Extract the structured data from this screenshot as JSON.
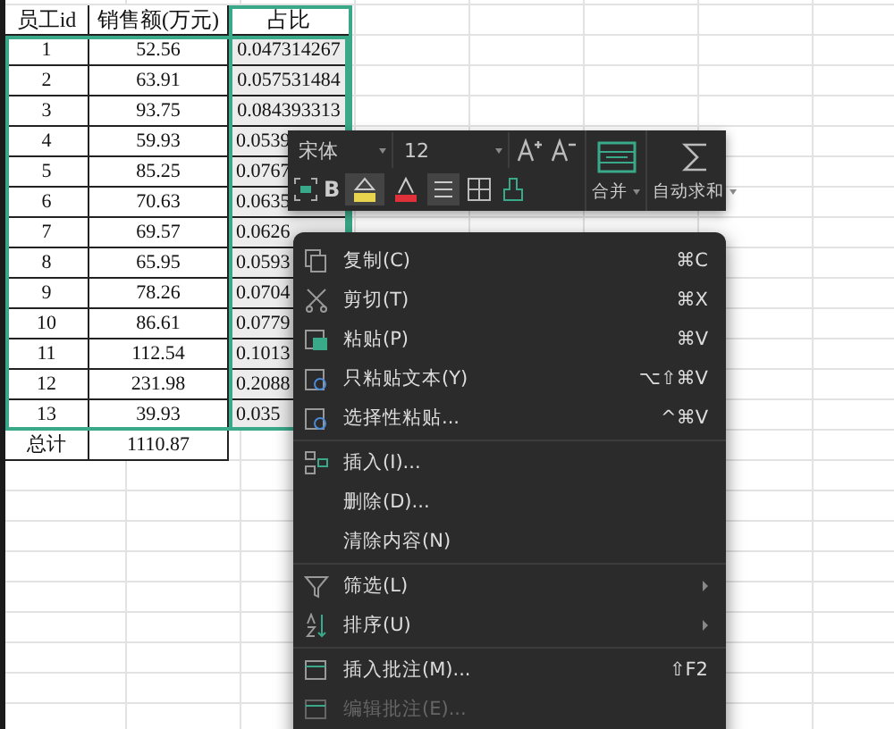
{
  "table": {
    "columns": [
      "员工id",
      "销售额(万元)",
      "占比"
    ],
    "rows": [
      [
        "1",
        "52.56",
        "0.047314267"
      ],
      [
        "2",
        "63.91",
        "0.057531484"
      ],
      [
        "3",
        "93.75",
        "0.084393313"
      ],
      [
        "4",
        "59.93",
        "0.0539"
      ],
      [
        "5",
        "85.25",
        "0.0767"
      ],
      [
        "6",
        "70.63",
        "0.0635"
      ],
      [
        "7",
        "69.57",
        "0.0626"
      ],
      [
        "8",
        "65.95",
        "0.0593"
      ],
      [
        "9",
        "78.26",
        "0.0704"
      ],
      [
        "10",
        "86.61",
        "0.0779"
      ],
      [
        "11",
        "112.54",
        "0.1013"
      ],
      [
        "12",
        "231.98",
        "0.2088"
      ],
      [
        "13",
        "39.93",
        "0.035"
      ],
      [
        "总计",
        "1110.87"
      ]
    ]
  },
  "toolbar": {
    "font": "宋体",
    "size": "12",
    "bold_label": "B",
    "merge_label": "合并",
    "autosum_label": "自动求和"
  },
  "context_menu": {
    "groups": [
      [
        {
          "label": "复制(C)",
          "shortcut": "⌘C",
          "disabled": false,
          "submenu": false
        },
        {
          "label": "剪切(T)",
          "shortcut": "⌘X",
          "disabled": false,
          "submenu": false
        },
        {
          "label": "粘贴(P)",
          "shortcut": "⌘V",
          "disabled": false,
          "submenu": false
        },
        {
          "label": "只粘贴文本(Y)",
          "shortcut": "⌥⇧⌘V",
          "disabled": false,
          "submenu": false
        },
        {
          "label": "选择性粘贴...",
          "shortcut": "^⌘V",
          "disabled": false,
          "submenu": false
        }
      ],
      [
        {
          "label": "插入(I)...",
          "disabled": false,
          "submenu": false
        },
        {
          "label": "删除(D)...",
          "disabled": false,
          "submenu": false
        },
        {
          "label": "清除内容(N)",
          "disabled": false,
          "submenu": false
        }
      ],
      [
        {
          "label": "筛选(L)",
          "disabled": false,
          "submenu": true
        },
        {
          "label": "排序(U)",
          "disabled": false,
          "submenu": true
        }
      ],
      [
        {
          "label": "插入批注(M)...",
          "shortcut": "⇧F2",
          "disabled": false,
          "submenu": false
        },
        {
          "label": "编辑批注(E)...",
          "disabled": true,
          "submenu": false
        }
      ]
    ]
  }
}
